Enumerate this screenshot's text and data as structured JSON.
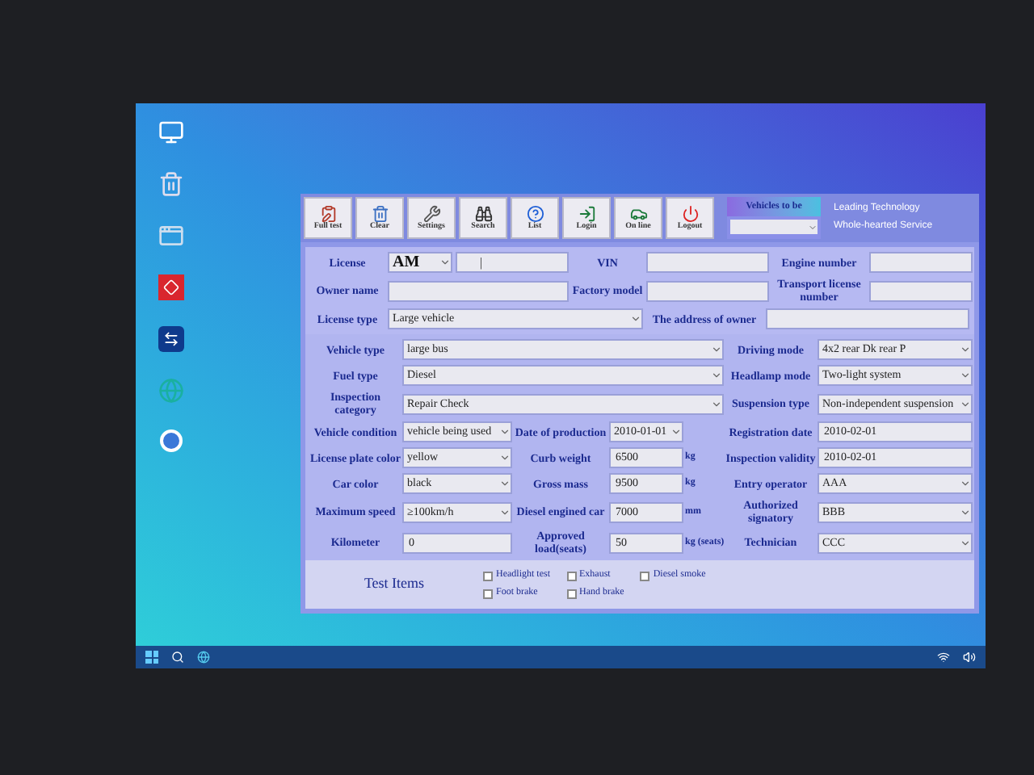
{
  "toolbar": [
    {
      "label": "Full test"
    },
    {
      "label": "Clear"
    },
    {
      "label": "Settings"
    },
    {
      "label": "Search"
    },
    {
      "label": "List"
    },
    {
      "label": "Login"
    },
    {
      "label": "On line"
    },
    {
      "label": "Logout"
    }
  ],
  "vehicles_panel": {
    "title": "Vehicles to be"
  },
  "slogan": [
    "Leading Technology",
    "Whole-hearted Service"
  ],
  "license": {
    "label": "License",
    "prefix": "AM",
    "value": "|"
  },
  "top_fields": [
    {
      "label": "VIN"
    },
    {
      "label": "Engine number"
    },
    {
      "label": "Owner name"
    },
    {
      "label": "Factory model"
    },
    {
      "label": "Transport license number"
    }
  ],
  "license_type": {
    "label": "License type",
    "value": "Large vehicle"
  },
  "owner_address": {
    "label": "The address of owner"
  },
  "rows": [
    {
      "left": {
        "label": "Vehicle type",
        "value": "large bus"
      },
      "right": {
        "label": "Driving mode",
        "value": "4x2 rear Dk rear P"
      }
    },
    {
      "left": {
        "label": "Fuel type",
        "value": "Diesel"
      },
      "right": {
        "label": "Headlamp mode",
        "value": "Two-light system"
      }
    },
    {
      "left": {
        "label": "Inspection category",
        "value": "Repair Check"
      },
      "right": {
        "label": "Suspension type",
        "value": "Non-independent suspension"
      }
    },
    {
      "left": {
        "label": "Vehicle condition",
        "value": "vehicle being used"
      },
      "middle": {
        "label": "Date of production",
        "value": "2010-01-01",
        "kind": "select"
      },
      "right": {
        "label": "Registration date",
        "value": "2010-02-01"
      }
    },
    {
      "left": {
        "label": "License plate color",
        "value": "yellow"
      },
      "middle": {
        "label": "Curb weight",
        "value": "6500",
        "kind": "input",
        "unit": "kg"
      },
      "right": {
        "label": "Inspection validity",
        "value": "2010-02-01"
      }
    },
    {
      "left": {
        "label": "Car color",
        "value": "black"
      },
      "middle": {
        "label": "Gross mass",
        "value": "9500",
        "kind": "input",
        "unit": "kg"
      },
      "right": {
        "label": "Entry operator",
        "value": "AAA"
      }
    },
    {
      "left": {
        "label": "Maximum speed",
        "value": "≥100km/h"
      },
      "middle": {
        "label": "Diesel engined car",
        "value": "7000",
        "kind": "input",
        "unit": "mm"
      },
      "right": {
        "label": "Authorized signatory",
        "value": "BBB"
      }
    },
    {
      "left": {
        "label": "Kilometer",
        "value": "0",
        "kind": "input"
      },
      "middle": {
        "label": "Approved load(seats)",
        "value": "50",
        "kind": "input",
        "unit": "kg (seats)"
      },
      "right": {
        "label": "Technician",
        "value": "CCC"
      }
    }
  ],
  "test_items": {
    "title": "Test Items",
    "items": [
      {
        "label": "Headlight test",
        "checked": false
      },
      {
        "label": "Foot brake",
        "checked": false
      },
      {
        "label": "Exhaust",
        "checked": false
      },
      {
        "label": "Hand brake",
        "checked": false
      },
      {
        "label": "Diesel smoke",
        "checked": false
      }
    ]
  }
}
